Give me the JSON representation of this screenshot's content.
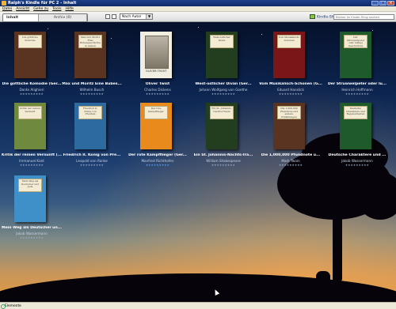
{
  "window": {
    "title": "Ralph's Kindle für PC 2 - Inhalt"
  },
  "menu": [
    "Datei",
    "Ansicht",
    "Gehe zu",
    "Tools",
    "Hilfe"
  ],
  "toolbar": {
    "tab_content": "Inhalt",
    "tab_archive": "Archiv (0)",
    "sort_value": "Nach Autor",
    "shop_label": "Kindle-Shop",
    "search_placeholder": "Bücher im Kindle-Shop suchen",
    "icons": [
      "grid-view-icon",
      "list-view-icon",
      "cart-icon"
    ]
  },
  "books": [
    {
      "title": "Die göttliche Komödie (Ger...",
      "author": "Dante Alighieri",
      "cover_text": "Die göttliche Komödie",
      "color": "brown",
      "rated": false
    },
    {
      "title": "Max und Moritz Eine Bubes...",
      "author": "Wilhelm Busch",
      "cover_text": "Max und Moritz Eine Bubengeschichte in sieben Streichen",
      "color": "brown",
      "rated": false
    },
    {
      "title": "Oliver Twist",
      "author": "Charles Dickens",
      "cover_text": "OLIVER TWIST",
      "color": "plain",
      "rated": false
    },
    {
      "title": "West-östlicher Divan (Ger...",
      "author": "Johann Wolfgang von Goethe",
      "cover_text": "West-östlicher Divan",
      "color": "darkgreen",
      "rated": false
    },
    {
      "title": "Vom Musikalisch-Schönen (G...",
      "author": "Eduard Hanslick",
      "cover_text": "Vom Musikalisch-Schönen",
      "color": "red",
      "rated": false
    },
    {
      "title": "Der Struwwelpeter oder lu...",
      "author": "Heinrich Hoffmann",
      "cover_text": "Der Struwwelpeter oder lustige Geschichten",
      "color": "green",
      "rated": false
    },
    {
      "title": "Kritik der reinen Vernunft (...",
      "author": "Immanuel Kant",
      "cover_text": "Kritik der reinen Vernunft",
      "color": "olive",
      "rated": false
    },
    {
      "title": "Friedrich II. König von Pre...",
      "author": "Leopold von Ranke",
      "cover_text": "Friedrich II. König von Preußen",
      "color": "blue",
      "rated": false
    },
    {
      "title": "Der rote Kampfflieger (Ger...",
      "author": "Manfred Richthofen",
      "cover_text": "Der rote Kampfflieger",
      "color": "orange",
      "rated": true
    },
    {
      "title": "Ein St. Johannis-Nachts-Tra...",
      "author": "William Shakespeare",
      "cover_text": "Ein St. Johannis-Nachts-Traum",
      "color": "darkgreen",
      "rated": false
    },
    {
      "title": "Die 1,000,000 Pfundnote u...",
      "author": "Mark Twain",
      "cover_text": "Die 1,000,000 Pfundnote und andere Erzählungen",
      "color": "brown",
      "rated": false
    },
    {
      "title": "Deutsche Charaktere und ...",
      "author": "Jakob Wassermann",
      "cover_text": "Deutsche Charaktere und Begebenheiten",
      "color": "green",
      "rated": false
    },
    {
      "title": "Mein Weg als Deutscher un...",
      "author": "Jakob Wassermann",
      "cover_text": "Mein Weg als Deutscher und Jude",
      "color": "lightblue",
      "rated": false
    }
  ],
  "stars_text": "★★★★★★★★★",
  "status": {
    "text": "Elemente"
  }
}
